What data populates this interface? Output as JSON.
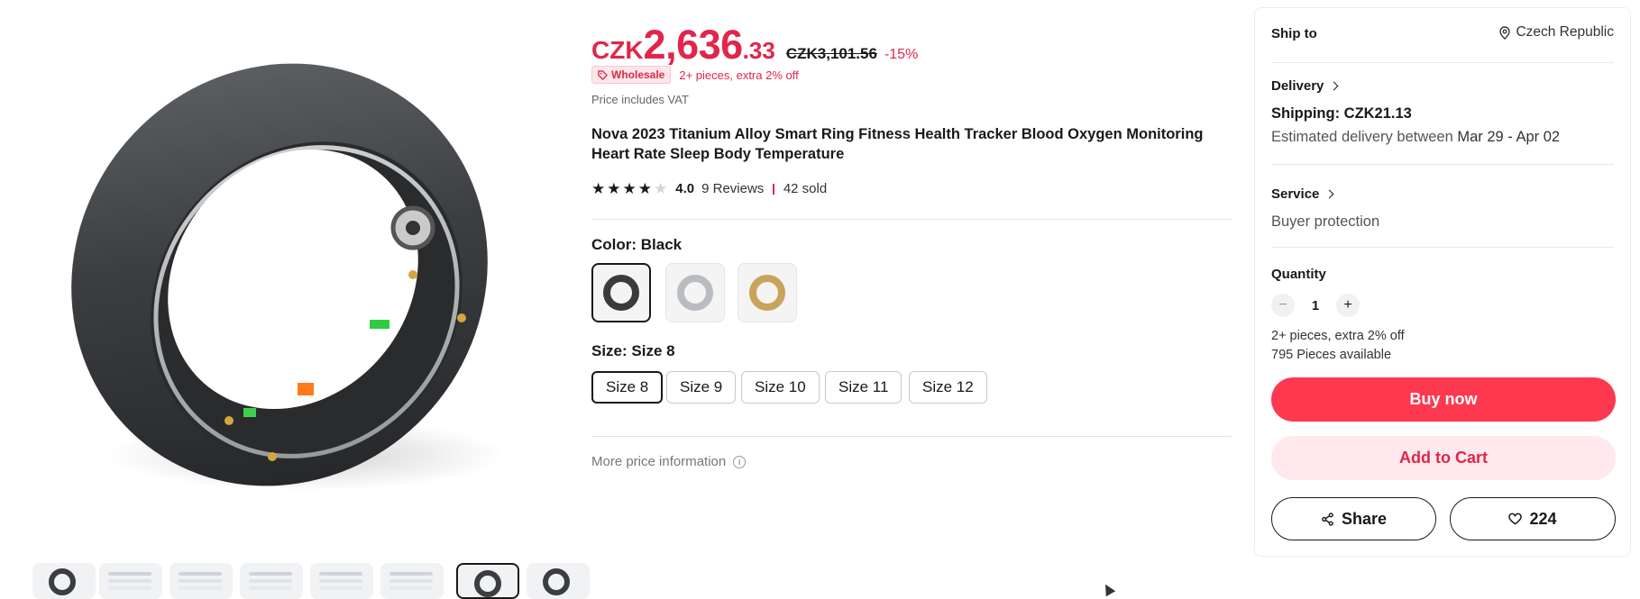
{
  "gallery": {
    "main_image_alt": "",
    "thumbnails": [
      {
        "kind": "ring"
      },
      {
        "kind": "doc"
      },
      {
        "kind": "doc"
      },
      {
        "kind": "doc"
      },
      {
        "kind": "doc"
      },
      {
        "kind": "doc"
      },
      {
        "kind": "ring",
        "selected": true
      },
      {
        "kind": "ring"
      }
    ]
  },
  "price": {
    "currency": "CZK",
    "integer": "2,636",
    "decimal": ".33",
    "original": "CZK3,101.56",
    "discount": "-15%"
  },
  "wholesale": {
    "badge": "Wholesale",
    "text": "2+ pieces, extra 2% off"
  },
  "vat_note": "Price includes VAT",
  "product": {
    "title": "Nova 2023 Titanium Alloy Smart Ring Fitness Health Tracker Blood Oxygen Monitoring Heart Rate Sleep Body Temperature"
  },
  "rating": {
    "stars": 4,
    "max_stars": 5,
    "score": "4.0",
    "reviews": "9 Reviews",
    "sold": "42 sold"
  },
  "color": {
    "label": "Color: Black",
    "options": [
      {
        "name": "Black",
        "hex": "#3a3b3d",
        "selected": true
      },
      {
        "name": "Silver",
        "hex": "#b9bcc0",
        "selected": false
      },
      {
        "name": "Gold",
        "hex": "#c8a35a",
        "selected": false
      }
    ]
  },
  "size": {
    "label": "Size: Size 8",
    "options": [
      "Size 8",
      "Size 9",
      "Size 10",
      "Size 11",
      "Size 12"
    ],
    "selected_index": 0
  },
  "more_price_info": "More price information",
  "card": {
    "ship_to_label": "Ship to",
    "ship_to_value": "Czech Republic",
    "delivery_label": "Delivery",
    "shipping": "Shipping: CZK21.13",
    "estimated_prefix": "Estimated delivery between",
    "estimated_dates": "Mar 29 - Apr 02",
    "service_label": "Service",
    "service_value": "Buyer protection",
    "quantity_label": "Quantity",
    "quantity_value": "1",
    "quantity_minus": "−",
    "quantity_plus": "+",
    "wholesale_note": "2+ pieces, extra 2% off",
    "available": "795 Pieces available",
    "buy_now": "Buy now",
    "add_to_cart": "Add to Cart",
    "share": "Share",
    "wishlist_count": "224"
  },
  "colors": {
    "accent": "#e1264a",
    "buy_now_bg": "#fd384f",
    "add_to_cart_bg": "#ffe9ec",
    "add_to_cart_text": "#e1264a"
  }
}
